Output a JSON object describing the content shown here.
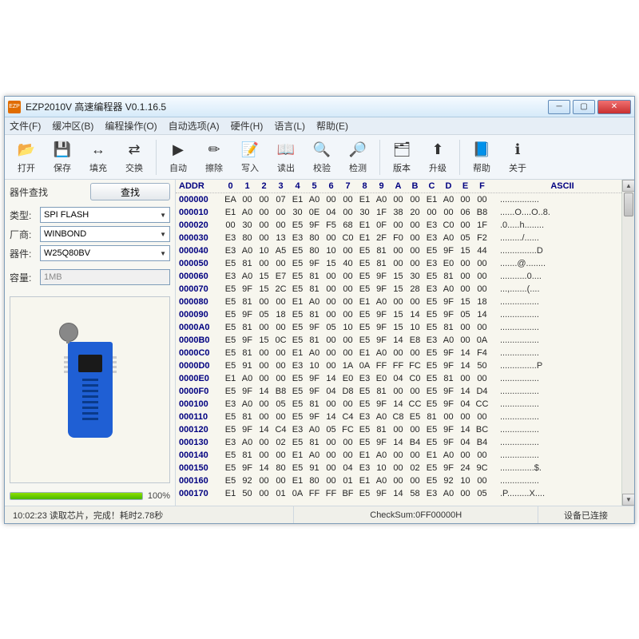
{
  "window": {
    "title": "EZP2010V 高速编程器  V0.1.16.5"
  },
  "menu": [
    "文件(F)",
    "缓冲区(B)",
    "编程操作(O)",
    "自动选项(A)",
    "硬件(H)",
    "语言(L)",
    "帮助(E)"
  ],
  "toolbar": [
    {
      "label": "打开",
      "icon": "📂"
    },
    {
      "label": "保存",
      "icon": "💾"
    },
    {
      "label": "填充",
      "icon": "↔"
    },
    {
      "label": "交换",
      "icon": "⇄"
    },
    {
      "sep": true
    },
    {
      "label": "自动",
      "icon": "▶"
    },
    {
      "label": "擦除",
      "icon": "✏"
    },
    {
      "label": "写入",
      "icon": "📝"
    },
    {
      "label": "读出",
      "icon": "📖"
    },
    {
      "label": "校验",
      "icon": "🔍"
    },
    {
      "label": "检测",
      "icon": "🔎"
    },
    {
      "sep": true
    },
    {
      "label": "版本",
      "icon": "🗂"
    },
    {
      "label": "升级",
      "icon": "⬆"
    },
    {
      "sep": true
    },
    {
      "label": "帮助",
      "icon": "📘"
    },
    {
      "label": "关于",
      "icon": "ℹ"
    }
  ],
  "side": {
    "find_section": "器件查找",
    "find_btn": "查找",
    "type_label": "类型:",
    "type_value": "SPI FLASH",
    "vendor_label": "厂商:",
    "vendor_value": "WINBOND",
    "part_label": "器件:",
    "part_value": "W25Q80BV",
    "cap_label": "容量:",
    "cap_value": "1MB",
    "progress_pct": 100,
    "progress_label": "100%"
  },
  "hex": {
    "addr_label": "ADDR",
    "ascii_label": "ASCII",
    "cols": [
      "0",
      "1",
      "2",
      "3",
      "4",
      "5",
      "6",
      "7",
      "8",
      "9",
      "A",
      "B",
      "C",
      "D",
      "E",
      "F"
    ],
    "rows": [
      {
        "a": "000000",
        "b": [
          "EA",
          "00",
          "00",
          "07",
          "E1",
          "A0",
          "00",
          "00",
          "E1",
          "A0",
          "00",
          "00",
          "E1",
          "A0",
          "00",
          "00"
        ],
        "s": "................"
      },
      {
        "a": "000010",
        "b": [
          "E1",
          "A0",
          "00",
          "00",
          "30",
          "0E",
          "04",
          "00",
          "30",
          "1F",
          "38",
          "20",
          "00",
          "00",
          "06",
          "B8"
        ],
        "s": "......O....O..8."
      },
      {
        "a": "000020",
        "b": [
          "00",
          "30",
          "00",
          "00",
          "E5",
          "9F",
          "F5",
          "68",
          "E1",
          "0F",
          "00",
          "00",
          "E3",
          "C0",
          "00",
          "1F"
        ],
        "s": ".0.....h........"
      },
      {
        "a": "000030",
        "b": [
          "E3",
          "80",
          "00",
          "13",
          "E3",
          "80",
          "00",
          "C0",
          "E1",
          "2F",
          "F0",
          "00",
          "E3",
          "A0",
          "05",
          "F2"
        ],
        "s": "........./......"
      },
      {
        "a": "000040",
        "b": [
          "E3",
          "A0",
          "10",
          "A5",
          "E5",
          "80",
          "10",
          "00",
          "E5",
          "81",
          "00",
          "00",
          "E5",
          "9F",
          "15",
          "44"
        ],
        "s": "...............D"
      },
      {
        "a": "000050",
        "b": [
          "E5",
          "81",
          "00",
          "00",
          "E5",
          "9F",
          "15",
          "40",
          "E5",
          "81",
          "00",
          "00",
          "E3",
          "E0",
          "00",
          "00"
        ],
        "s": ".......@........"
      },
      {
        "a": "000060",
        "b": [
          "E3",
          "A0",
          "15",
          "E7",
          "E5",
          "81",
          "00",
          "00",
          "E5",
          "9F",
          "15",
          "30",
          "E5",
          "81",
          "00",
          "00"
        ],
        "s": "...........0...."
      },
      {
        "a": "000070",
        "b": [
          "E5",
          "9F",
          "15",
          "2C",
          "E5",
          "81",
          "00",
          "00",
          "E5",
          "9F",
          "15",
          "28",
          "E3",
          "A0",
          "00",
          "00"
        ],
        "s": "...,.......(...."
      },
      {
        "a": "000080",
        "b": [
          "E5",
          "81",
          "00",
          "00",
          "E1",
          "A0",
          "00",
          "00",
          "E1",
          "A0",
          "00",
          "00",
          "E5",
          "9F",
          "15",
          "18"
        ],
        "s": "................"
      },
      {
        "a": "000090",
        "b": [
          "E5",
          "9F",
          "05",
          "18",
          "E5",
          "81",
          "00",
          "00",
          "E5",
          "9F",
          "15",
          "14",
          "E5",
          "9F",
          "05",
          "14"
        ],
        "s": "................"
      },
      {
        "a": "0000A0",
        "b": [
          "E5",
          "81",
          "00",
          "00",
          "E5",
          "9F",
          "05",
          "10",
          "E5",
          "9F",
          "15",
          "10",
          "E5",
          "81",
          "00",
          "00"
        ],
        "s": "................"
      },
      {
        "a": "0000B0",
        "b": [
          "E5",
          "9F",
          "15",
          "0C",
          "E5",
          "81",
          "00",
          "00",
          "E5",
          "9F",
          "14",
          "E8",
          "E3",
          "A0",
          "00",
          "0A"
        ],
        "s": "................"
      },
      {
        "a": "0000C0",
        "b": [
          "E5",
          "81",
          "00",
          "00",
          "E1",
          "A0",
          "00",
          "00",
          "E1",
          "A0",
          "00",
          "00",
          "E5",
          "9F",
          "14",
          "F4"
        ],
        "s": "................"
      },
      {
        "a": "0000D0",
        "b": [
          "E5",
          "91",
          "00",
          "00",
          "E3",
          "10",
          "00",
          "1A",
          "0A",
          "FF",
          "FF",
          "FC",
          "E5",
          "9F",
          "14",
          "50"
        ],
        "s": "...............P"
      },
      {
        "a": "0000E0",
        "b": [
          "E1",
          "A0",
          "00",
          "00",
          "E5",
          "9F",
          "14",
          "E0",
          "E3",
          "E0",
          "04",
          "C0",
          "E5",
          "81",
          "00",
          "00"
        ],
        "s": "................"
      },
      {
        "a": "0000F0",
        "b": [
          "E5",
          "9F",
          "14",
          "B8",
          "E5",
          "9F",
          "04",
          "D8",
          "E5",
          "81",
          "00",
          "00",
          "E5",
          "9F",
          "14",
          "D4"
        ],
        "s": "................"
      },
      {
        "a": "000100",
        "b": [
          "E3",
          "A0",
          "00",
          "05",
          "E5",
          "81",
          "00",
          "00",
          "E5",
          "9F",
          "14",
          "CC",
          "E5",
          "9F",
          "04",
          "CC"
        ],
        "s": "................"
      },
      {
        "a": "000110",
        "b": [
          "E5",
          "81",
          "00",
          "00",
          "E5",
          "9F",
          "14",
          "C4",
          "E3",
          "A0",
          "C8",
          "E5",
          "81",
          "00",
          "00",
          "00"
        ],
        "s": "................"
      },
      {
        "a": "000120",
        "b": [
          "E5",
          "9F",
          "14",
          "C4",
          "E3",
          "A0",
          "05",
          "FC",
          "E5",
          "81",
          "00",
          "00",
          "E5",
          "9F",
          "14",
          "BC"
        ],
        "s": "................"
      },
      {
        "a": "000130",
        "b": [
          "E3",
          "A0",
          "00",
          "02",
          "E5",
          "81",
          "00",
          "00",
          "E5",
          "9F",
          "14",
          "B4",
          "E5",
          "9F",
          "04",
          "B4"
        ],
        "s": "................"
      },
      {
        "a": "000140",
        "b": [
          "E5",
          "81",
          "00",
          "00",
          "E1",
          "A0",
          "00",
          "00",
          "E1",
          "A0",
          "00",
          "00",
          "E1",
          "A0",
          "00",
          "00"
        ],
        "s": "................"
      },
      {
        "a": "000150",
        "b": [
          "E5",
          "9F",
          "14",
          "80",
          "E5",
          "91",
          "00",
          "04",
          "E3",
          "10",
          "00",
          "02",
          "E5",
          "9F",
          "24",
          "9C"
        ],
        "s": "..............$."
      },
      {
        "a": "000160",
        "b": [
          "E5",
          "92",
          "00",
          "00",
          "E1",
          "80",
          "00",
          "01",
          "E1",
          "A0",
          "00",
          "00",
          "E5",
          "92",
          "10",
          "00"
        ],
        "s": "................"
      },
      {
        "a": "000170",
        "b": [
          "E1",
          "50",
          "00",
          "01",
          "0A",
          "FF",
          "FF",
          "BF",
          "E5",
          "9F",
          "14",
          "58",
          "E3",
          "A0",
          "00",
          "05"
        ],
        "s": ".P.........X...."
      }
    ]
  },
  "status": {
    "left": "10:02:23 读取芯片，完成！耗时2.78秒",
    "checksum": "CheckSum:0FF00000H",
    "conn": "设备已连接"
  }
}
